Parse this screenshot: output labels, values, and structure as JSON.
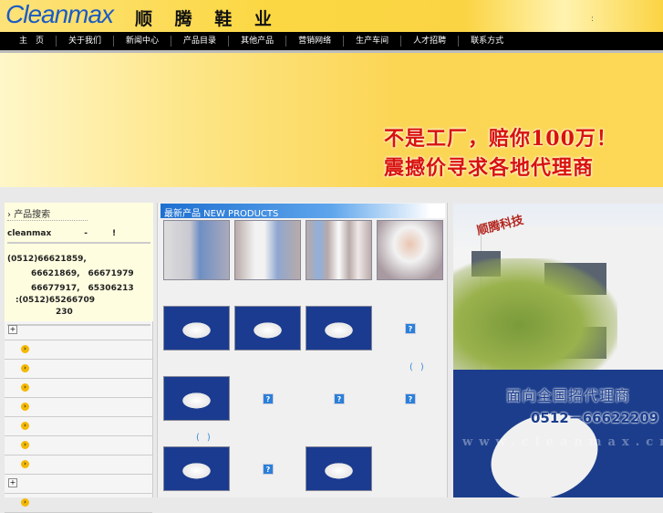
{
  "header": {
    "logo": "Cleanmax",
    "brand": "顺 腾 鞋 业",
    "colon": ":"
  },
  "nav": [
    "主　页",
    "关于我们",
    "新闻中心",
    "产品目录",
    "其他产品",
    "营销网络",
    "生产车间",
    "人才招聘",
    "联系方式"
  ],
  "banner": {
    "line1": "不是工厂，赔你100万！",
    "line2": "震撼价寻求各地代理商"
  },
  "sidebar": {
    "title": "产品搜索",
    "company_line": "cleanmax　　　　-　　　!",
    "phones": [
      "(0512)66621859,",
      "66621869,　66671979",
      "66677917,　65306213",
      ":(0512)65266709",
      "230"
    ],
    "expand_symbol": "+",
    "bullet_symbol": "›"
  },
  "products": {
    "title": "最新产品 NEW PRODUCTS",
    "missing_icon": "?",
    "paren": "()"
  },
  "right": {
    "building_sign": "顺腾科技",
    "slogan": "面向全国招代理商",
    "phone": "0512－66622209",
    "watermark": "www.cleanmax.cn"
  }
}
